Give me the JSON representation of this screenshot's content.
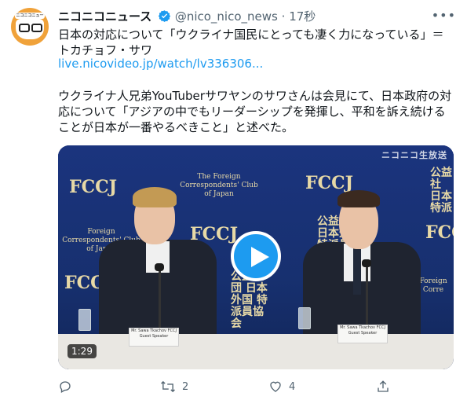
{
  "tweet": {
    "author_name": "ニコニコニュース",
    "handle": "@nico_nico_news",
    "separator": "·",
    "time": "17秒",
    "avatar_tag": "ニコニコニュース",
    "text_line": "日本の対応について「ウクライナ国民にとっても凄く力になっている」＝トカチョフ・サワ",
    "link": "live.nicovideo.jp/watch/lv336306...",
    "body": "ウクライナ人兄弟YouTuberサワヤンのサワさんは会見にて、日本政府の対応について「アジアの中でもリーダーシップを発揮し、平和を訴え続けることが日本が一番やるべきこと」と述べた。"
  },
  "media": {
    "duration": "1:29",
    "watermark": "ニコニコ生放送",
    "backdrop_logo": "FCCJ",
    "backdrop_caption": "The Foreign Correspondents' Club of Japan",
    "backdrop_left_caption": "Foreign Correspondents' Club of Japan",
    "backdrop_jp": "公益社団 日本外国 特派員協会",
    "backdrop_jp_right": "公益社 日本 特派",
    "backdrop_right_caption": "Foreign Corre",
    "placard_left": "Mr. Sawa Tkachov FCCJ Guest Speaker",
    "placard_right": "Mr. Sawa Tkachov FCCJ Guest Speaker"
  },
  "actions": {
    "reply_count": "",
    "retweet_count": "2",
    "like_count": "4"
  },
  "colors": {
    "accent": "#1d9bf0",
    "muted": "#536471",
    "verified": "#1d9bf0"
  },
  "icons": [
    "more-icon",
    "verified-icon",
    "reply-icon",
    "retweet-icon",
    "like-icon",
    "share-icon",
    "play-icon"
  ]
}
